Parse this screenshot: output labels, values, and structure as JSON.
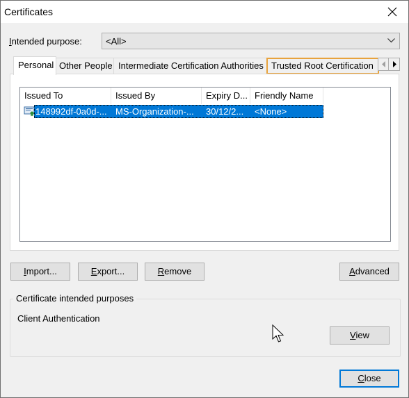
{
  "window": {
    "title": "Certificates"
  },
  "intended_purpose": {
    "label_prefix": "I",
    "label_rest": "ntended purpose:",
    "value": "<All>"
  },
  "tabs": [
    {
      "label": "Personal",
      "active": true
    },
    {
      "label": "Other People"
    },
    {
      "label": "Intermediate Certification Authorities"
    },
    {
      "label": "Trusted Root Certification",
      "focused": true
    }
  ],
  "list": {
    "columns": [
      "Issued To",
      "Issued By",
      "Expiry D...",
      "Friendly Name"
    ],
    "rows": [
      {
        "issued_to": "148992df-0a0d-...",
        "issued_by": "MS-Organization-...",
        "expiry": "30/12/2...",
        "friendly_name": "<None>",
        "selected": true
      }
    ]
  },
  "buttons": {
    "import": {
      "mn": "I",
      "rest": "mport..."
    },
    "export": {
      "mn": "E",
      "rest": "xport..."
    },
    "remove": {
      "mn": "R",
      "rest": "emove"
    },
    "advanced": {
      "mn": "A",
      "rest": "dvanced"
    },
    "view": {
      "mn": "V",
      "rest": "iew"
    },
    "close": {
      "mn": "C",
      "rest": "lose"
    }
  },
  "purposes": {
    "group_label": "Certificate intended purposes",
    "value": "Client Authentication"
  },
  "colors": {
    "selection": "#0078d7",
    "focus_outline": "#e8a33d"
  },
  "icons": [
    "close-icon",
    "dropdown-arrow-icon",
    "tab-scroll-left-icon",
    "tab-scroll-right-icon",
    "certificate-icon",
    "mouse-cursor-icon"
  ]
}
